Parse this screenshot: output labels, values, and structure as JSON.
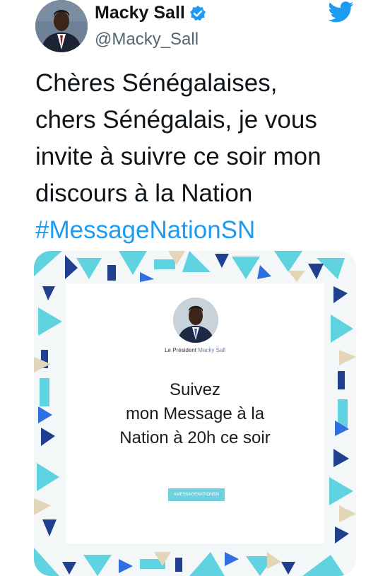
{
  "tweet": {
    "author_name": "Macky Sall",
    "handle": "@Macky_Sall",
    "text_lines": [
      "Chères Sénégalaises,",
      "chers Sénégalais, je vous",
      "invite à suivre ce soir mon",
      "discours à la Nation"
    ],
    "hashtag": "#MessageNationSN"
  },
  "card": {
    "president_label": "Le Président",
    "president_name": "Macky Sall",
    "message_lines": [
      "Suivez",
      "mon Message à la",
      "Nation à 20h ce soir"
    ],
    "tag": "#MESSAGENATIONSN"
  },
  "icons": {
    "verified": "verified-badge-icon",
    "brand": "twitter-bird-icon"
  },
  "colors": {
    "link": "#1d9bf0",
    "pattern_teal": "#5fd3e0",
    "pattern_navy": "#1f3f8f",
    "pattern_blue": "#2f6fe0",
    "pattern_sand": "#e3d6b8"
  }
}
